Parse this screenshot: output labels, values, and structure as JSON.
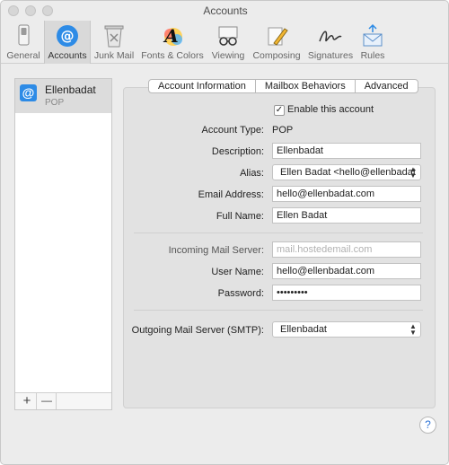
{
  "window": {
    "title": "Accounts"
  },
  "toolbar": {
    "items": [
      {
        "label": "General",
        "icon": "switch-icon"
      },
      {
        "label": "Accounts",
        "icon": "at-sign-icon"
      },
      {
        "label": "Junk Mail",
        "icon": "trash-can-icon"
      },
      {
        "label": "Fonts & Colors",
        "icon": "font-palette-icon"
      },
      {
        "label": "Viewing",
        "icon": "glasses-icon"
      },
      {
        "label": "Composing",
        "icon": "pencil-icon"
      },
      {
        "label": "Signatures",
        "icon": "signature-icon"
      },
      {
        "label": "Rules",
        "icon": "envelope-arrows-icon"
      }
    ],
    "selected": "Accounts"
  },
  "sidebar": {
    "account": {
      "name": "Ellenbadat",
      "type": "POP",
      "icon_glyph": "@"
    },
    "add_label": "+",
    "remove_label": "—"
  },
  "tabs": [
    "Account Information",
    "Mailbox Behaviors",
    "Advanced"
  ],
  "form": {
    "enable_label": "Enable this account",
    "enable_checked": true,
    "account_type_label": "Account Type:",
    "account_type_value": "POP",
    "description_label": "Description:",
    "description_value": "Ellenbadat",
    "alias_label": "Alias:",
    "alias_value": "Ellen Badat <hello@ellenbadat",
    "email_label": "Email Address:",
    "email_value": "hello@ellenbadat.com",
    "fullname_label": "Full Name:",
    "fullname_value": "Ellen Badat",
    "incoming_label": "Incoming Mail Server:",
    "incoming_placeholder": "mail.hostedemail.com",
    "username_label": "User Name:",
    "username_value": "hello@ellenbadat.com",
    "password_label": "Password:",
    "password_value": "•••••••••",
    "outgoing_label": "Outgoing Mail Server (SMTP):",
    "outgoing_value": "Ellenbadat"
  },
  "help_label": "?",
  "colors": {
    "accent": "#2d8be6",
    "window_bg": "#ececec",
    "panel_bg": "#e2e2e2"
  }
}
